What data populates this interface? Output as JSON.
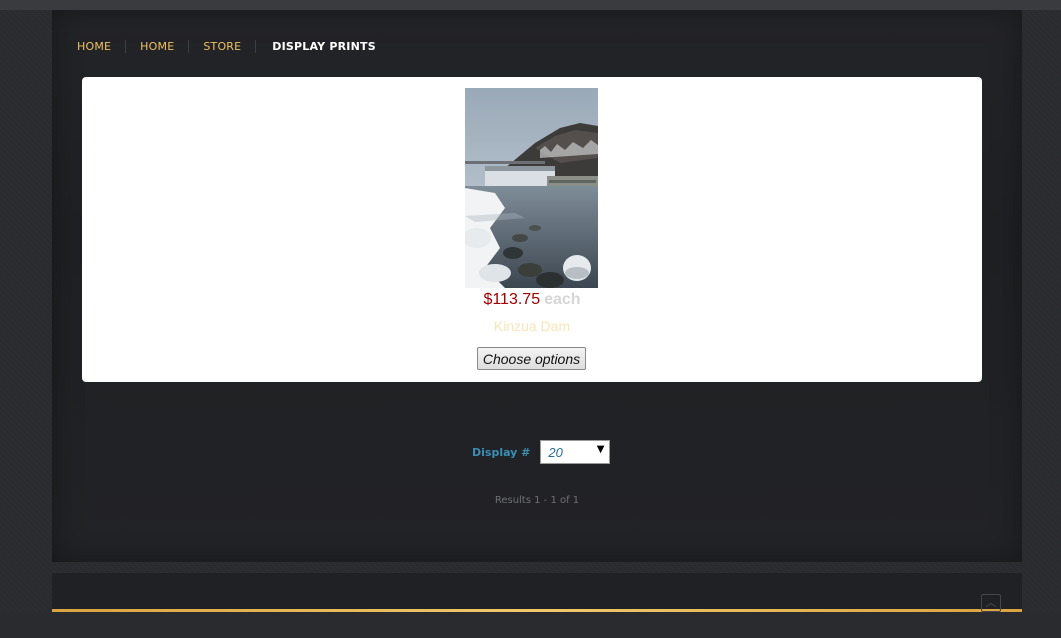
{
  "breadcrumb": {
    "items": [
      "HOME",
      "HOME",
      "STORE"
    ],
    "current": "DISPLAY PRINTS"
  },
  "product": {
    "price": "$113.75",
    "price_unit": "each",
    "title": "Kinzua Dam",
    "options_label": "Choose options"
  },
  "pagination": {
    "display_label": "Display #",
    "display_value": "20",
    "results_text": "Results 1 - 1 of 1"
  },
  "icons": {
    "select_arrow": "chevron-down-icon",
    "scroll_top": "chevron-up-icon"
  },
  "colors": {
    "breadcrumb_link": "#f0c060",
    "price": "#a00000",
    "accent_line": "#f2c96a",
    "display_label": "#3b8fb3"
  }
}
